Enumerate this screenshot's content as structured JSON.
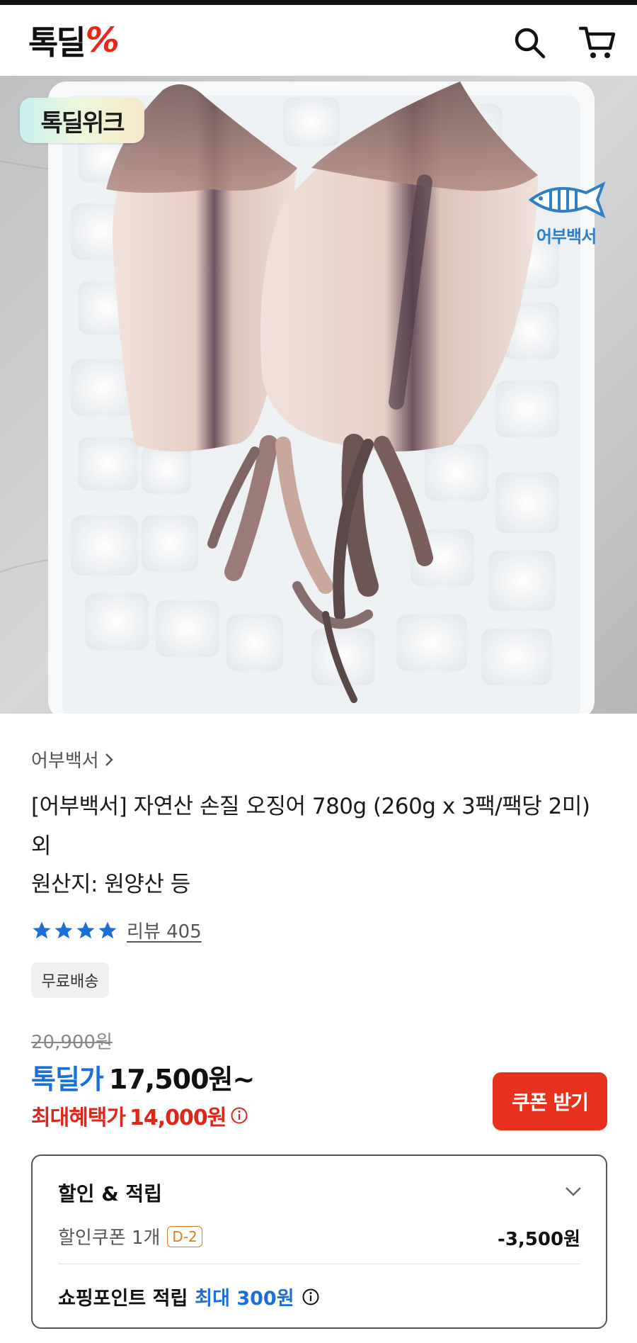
{
  "header": {
    "logo_text": "톡딜",
    "logo_symbol": "%",
    "icons": [
      "search-icon",
      "cart-icon"
    ],
    "colors": {
      "brand_red": "#e8261b"
    }
  },
  "hero": {
    "badge_left": "톡딜위크",
    "brand_badge_label": "어부백서",
    "carousel": {
      "count": 4,
      "active": 1
    }
  },
  "product": {
    "seller": "어부백서",
    "title": "[어부백서] 자연산 손질 오징어 780g (260g x 3팩/팩당 2미) 외",
    "origin": "원산지: 원양산 등",
    "rating": {
      "stars": 4,
      "review_label": "리뷰 405"
    },
    "shipping_badge": "무료배송"
  },
  "price": {
    "original": "20,900원",
    "deal_label": "톡딜가",
    "deal_price": "17,500원~",
    "max_label": "최대혜택가",
    "max_price": "14,000원",
    "coupon_button": "쿠폰 받기",
    "colors": {
      "deal_blue": "#1a6fd8",
      "max_red": "#e0251b",
      "coupon_btn": "#e8321e"
    }
  },
  "benefits": {
    "title": "할인 & 적립",
    "coupon_label": "할인쿠폰 1개",
    "coupon_badge": "D-2",
    "coupon_discount": "-3,500원",
    "point_label": "쇼핑포인트 적립",
    "point_value": "최대 300원"
  }
}
